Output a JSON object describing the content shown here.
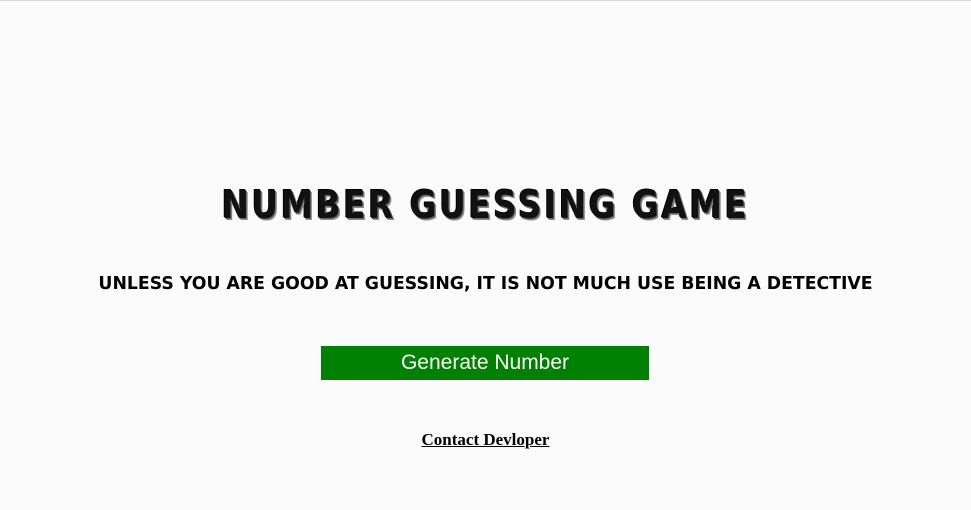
{
  "game": {
    "title": "NUMBER GUESSING GAME",
    "tagline": "UNLESS YOU ARE GOOD AT GUESSING, IT IS NOT MUCH USE BEING A DETECTIVE",
    "generate_button_label": "Generate Number",
    "contact_link_label": "Contact Devloper"
  },
  "colors": {
    "background": "#fbfbfb",
    "button_background": "#008000",
    "button_text": "#ffffff",
    "text": "#000000"
  }
}
